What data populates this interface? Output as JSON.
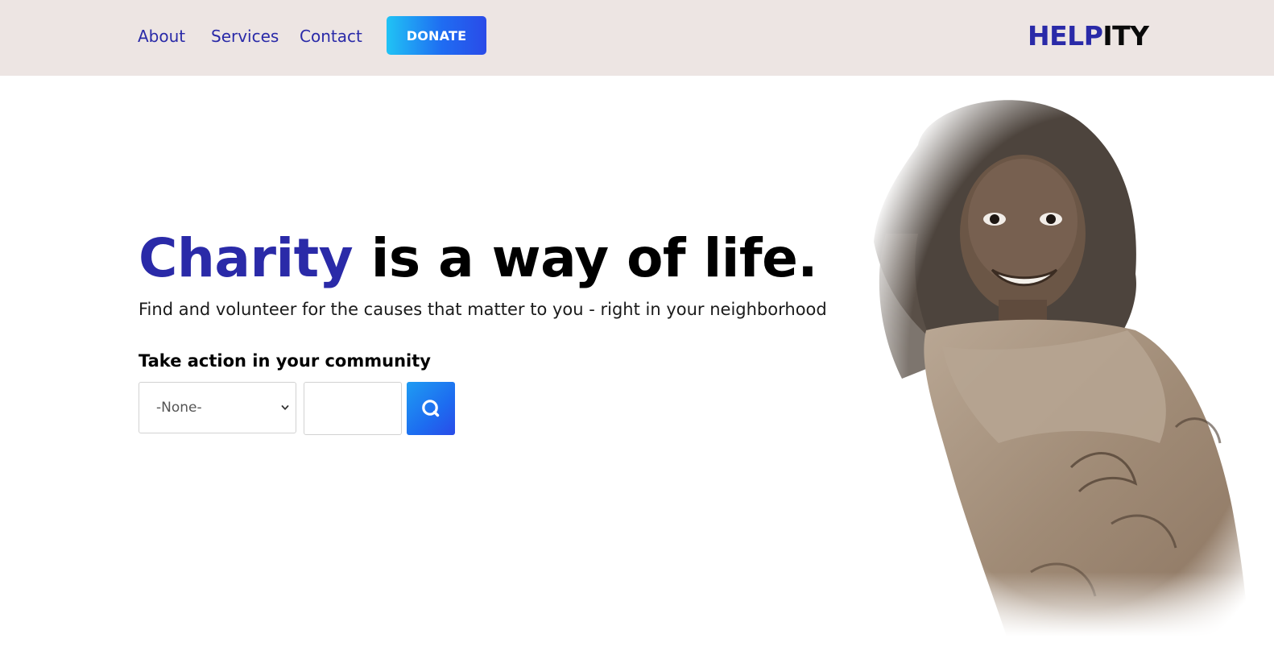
{
  "nav": {
    "links": [
      "About",
      "Services",
      "Contact"
    ],
    "donate_label": "DONATE"
  },
  "logo": {
    "part1": "HELP",
    "part2": "ITY"
  },
  "hero": {
    "title_highlight": "Charity",
    "title_rest": " is a way of life.",
    "subtitle": "Find and volunteer for the causes that matter to you - right in your neighborhood",
    "section_label": "Take action in your community"
  },
  "search": {
    "category_selected": "-None-",
    "zip_value": "",
    "icon": "search-icon"
  },
  "colors": {
    "brand": "#2a2aa8",
    "nav_bg": "#ede5e3",
    "button_gradient_start": "#20c3f5",
    "button_gradient_end": "#2a4be8"
  },
  "images": {
    "hero_photo": "smiling-girl-wrapped-in-shawl"
  }
}
